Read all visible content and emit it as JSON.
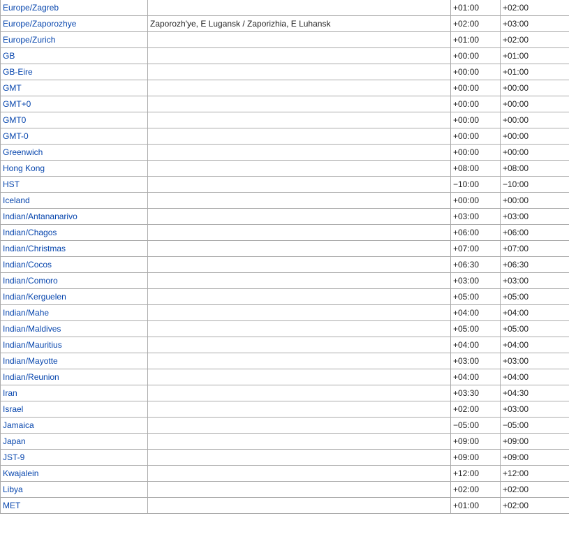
{
  "table": {
    "rows": [
      {
        "tz": "Europe/Zagreb",
        "comment": "",
        "utc_offset": "+01:00",
        "utc_dst_offset": "+02:00"
      },
      {
        "tz": "Europe/Zaporozhye",
        "comment": "Zaporozh'ye, E Lugansk / Zaporizhia, E Luhansk",
        "utc_offset": "+02:00",
        "utc_dst_offset": "+03:00"
      },
      {
        "tz": "Europe/Zurich",
        "comment": "",
        "utc_offset": "+01:00",
        "utc_dst_offset": "+02:00"
      },
      {
        "tz": "GB",
        "comment": "",
        "utc_offset": "+00:00",
        "utc_dst_offset": "+01:00"
      },
      {
        "tz": "GB-Eire",
        "comment": "",
        "utc_offset": "+00:00",
        "utc_dst_offset": "+01:00"
      },
      {
        "tz": "GMT",
        "comment": "",
        "utc_offset": "+00:00",
        "utc_dst_offset": "+00:00"
      },
      {
        "tz": "GMT+0",
        "comment": "",
        "utc_offset": "+00:00",
        "utc_dst_offset": "+00:00"
      },
      {
        "tz": "GMT0",
        "comment": "",
        "utc_offset": "+00:00",
        "utc_dst_offset": "+00:00"
      },
      {
        "tz": "GMT-0",
        "comment": "",
        "utc_offset": "+00:00",
        "utc_dst_offset": "+00:00"
      },
      {
        "tz": "Greenwich",
        "comment": "",
        "utc_offset": "+00:00",
        "utc_dst_offset": "+00:00"
      },
      {
        "tz": "Hong Kong",
        "comment": "",
        "utc_offset": "+08:00",
        "utc_dst_offset": "+08:00"
      },
      {
        "tz": "HST",
        "comment": "",
        "utc_offset": "−10:00",
        "utc_dst_offset": "−10:00"
      },
      {
        "tz": "Iceland",
        "comment": "",
        "utc_offset": "+00:00",
        "utc_dst_offset": "+00:00"
      },
      {
        "tz": "Indian/Antananarivo",
        "comment": "",
        "utc_offset": "+03:00",
        "utc_dst_offset": "+03:00"
      },
      {
        "tz": "Indian/Chagos",
        "comment": "",
        "utc_offset": "+06:00",
        "utc_dst_offset": "+06:00"
      },
      {
        "tz": "Indian/Christmas",
        "comment": "",
        "utc_offset": "+07:00",
        "utc_dst_offset": "+07:00"
      },
      {
        "tz": "Indian/Cocos",
        "comment": "",
        "utc_offset": "+06:30",
        "utc_dst_offset": "+06:30"
      },
      {
        "tz": "Indian/Comoro",
        "comment": "",
        "utc_offset": "+03:00",
        "utc_dst_offset": "+03:00"
      },
      {
        "tz": "Indian/Kerguelen",
        "comment": "",
        "utc_offset": "+05:00",
        "utc_dst_offset": "+05:00"
      },
      {
        "tz": "Indian/Mahe",
        "comment": "",
        "utc_offset": "+04:00",
        "utc_dst_offset": "+04:00"
      },
      {
        "tz": "Indian/Maldives",
        "comment": "",
        "utc_offset": "+05:00",
        "utc_dst_offset": "+05:00"
      },
      {
        "tz": "Indian/Mauritius",
        "comment": "",
        "utc_offset": "+04:00",
        "utc_dst_offset": "+04:00"
      },
      {
        "tz": "Indian/Mayotte",
        "comment": "",
        "utc_offset": "+03:00",
        "utc_dst_offset": "+03:00"
      },
      {
        "tz": "Indian/Reunion",
        "comment": "",
        "utc_offset": "+04:00",
        "utc_dst_offset": "+04:00"
      },
      {
        "tz": "Iran",
        "comment": "",
        "utc_offset": "+03:30",
        "utc_dst_offset": "+04:30"
      },
      {
        "tz": "Israel",
        "comment": "",
        "utc_offset": "+02:00",
        "utc_dst_offset": "+03:00"
      },
      {
        "tz": "Jamaica",
        "comment": "",
        "utc_offset": "−05:00",
        "utc_dst_offset": "−05:00"
      },
      {
        "tz": "Japan",
        "comment": "",
        "utc_offset": "+09:00",
        "utc_dst_offset": "+09:00"
      },
      {
        "tz": "JST-9",
        "comment": "",
        "utc_offset": "+09:00",
        "utc_dst_offset": "+09:00"
      },
      {
        "tz": "Kwajalein",
        "comment": "",
        "utc_offset": "+12:00",
        "utc_dst_offset": "+12:00"
      },
      {
        "tz": "Libya",
        "comment": "",
        "utc_offset": "+02:00",
        "utc_dst_offset": "+02:00"
      },
      {
        "tz": "MET",
        "comment": "",
        "utc_offset": "+01:00",
        "utc_dst_offset": "+02:00"
      }
    ]
  },
  "colors": {
    "link": "#0645ad",
    "text": "#222222",
    "border": "#aaaaaa",
    "background": "#ffffff"
  }
}
